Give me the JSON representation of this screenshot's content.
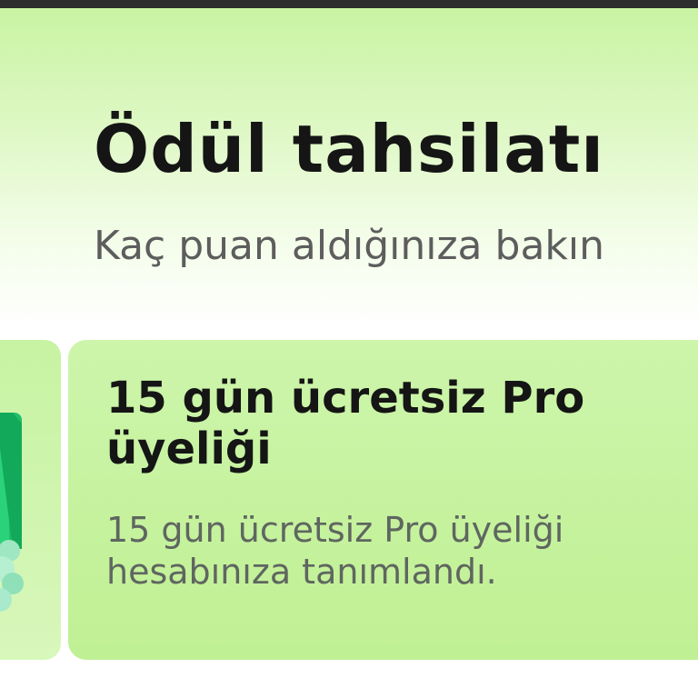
{
  "header": {
    "title": "Ödül tahsilatı",
    "subtitle": "Kaç puan aldığınıza bakın"
  },
  "reward": {
    "title": "15 gün ücretsiz Pro üyeliği",
    "description": "15 gün ücretsiz Pro üyeliği hesabınıza tanımlandı."
  },
  "colors": {
    "accent_green": "#c0f094",
    "title_text": "#151515",
    "muted_text": "#5d5d5d",
    "icon_green": "#22c45e"
  },
  "icons": {
    "reward_icon": "gift-icon"
  }
}
